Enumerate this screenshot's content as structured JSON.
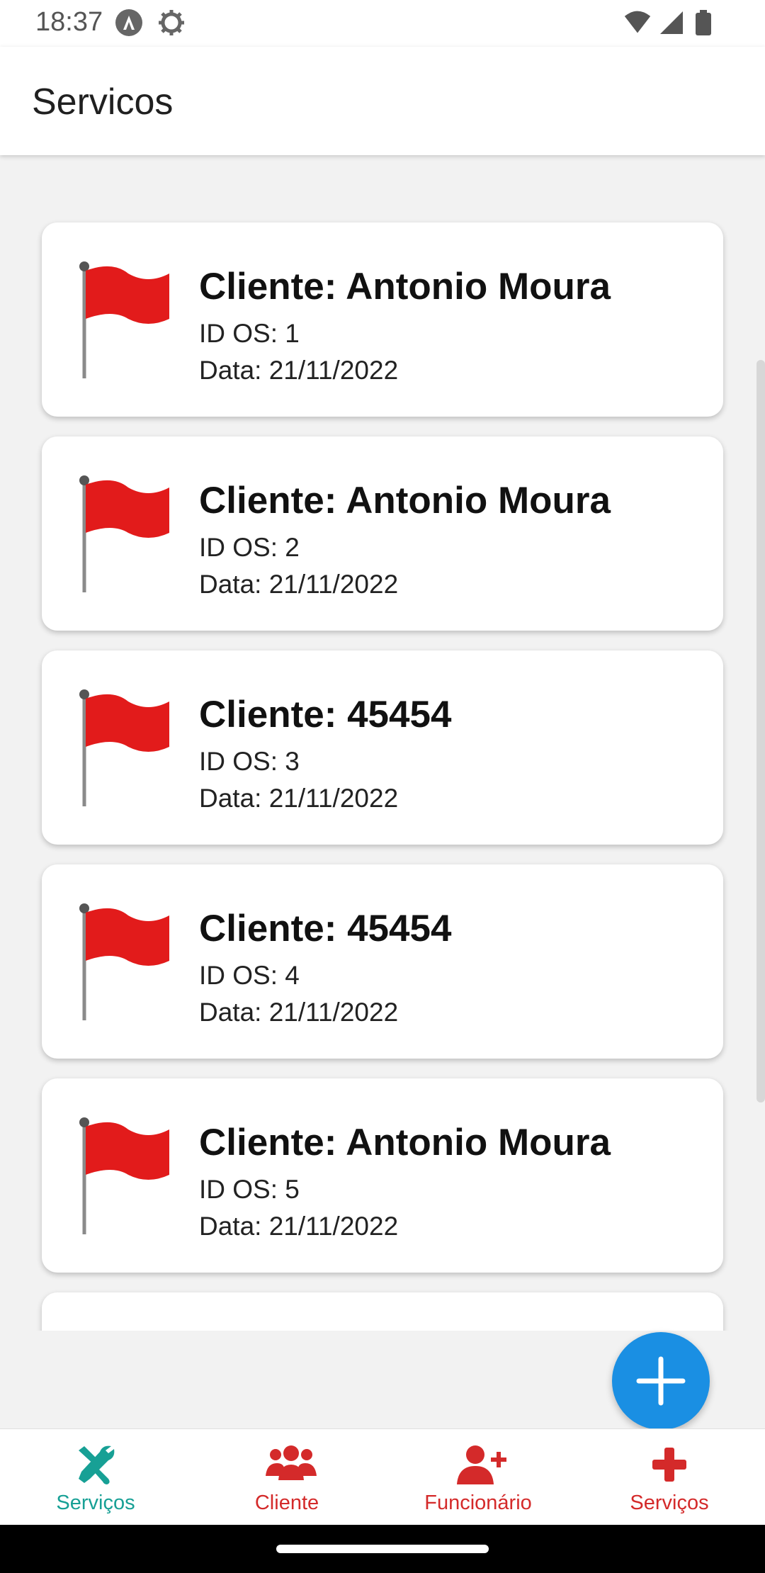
{
  "status_bar": {
    "time": "18:37"
  },
  "app_bar": {
    "title": "Servicos"
  },
  "colors": {
    "flag": "#e21b1b",
    "fab": "#1a8fe3",
    "active_tab": "#17a095",
    "inactive_tab": "#d42a2a"
  },
  "services": [
    {
      "title": "Cliente: Antonio Moura",
      "id_line": "ID OS: 1",
      "date_line": "Data: 21/11/2022"
    },
    {
      "title": "Cliente: Antonio Moura",
      "id_line": "ID OS: 2",
      "date_line": "Data: 21/11/2022"
    },
    {
      "title": "Cliente: 45454",
      "id_line": "ID OS: 3",
      "date_line": "Data: 21/11/2022"
    },
    {
      "title": "Cliente: 45454",
      "id_line": "ID OS: 4",
      "date_line": "Data: 21/11/2022"
    },
    {
      "title": "Cliente: Antonio Moura",
      "id_line": "ID OS: 5",
      "date_line": "Data: 21/11/2022"
    }
  ],
  "fab": {
    "icon": "plus-icon"
  },
  "bottom_nav": [
    {
      "label": "Serviços",
      "icon": "tools-icon"
    },
    {
      "label": "Cliente",
      "icon": "users-icon"
    },
    {
      "label": "Funcionário",
      "icon": "user-plus-icon"
    },
    {
      "label": "Serviços",
      "icon": "plus-icon"
    }
  ]
}
